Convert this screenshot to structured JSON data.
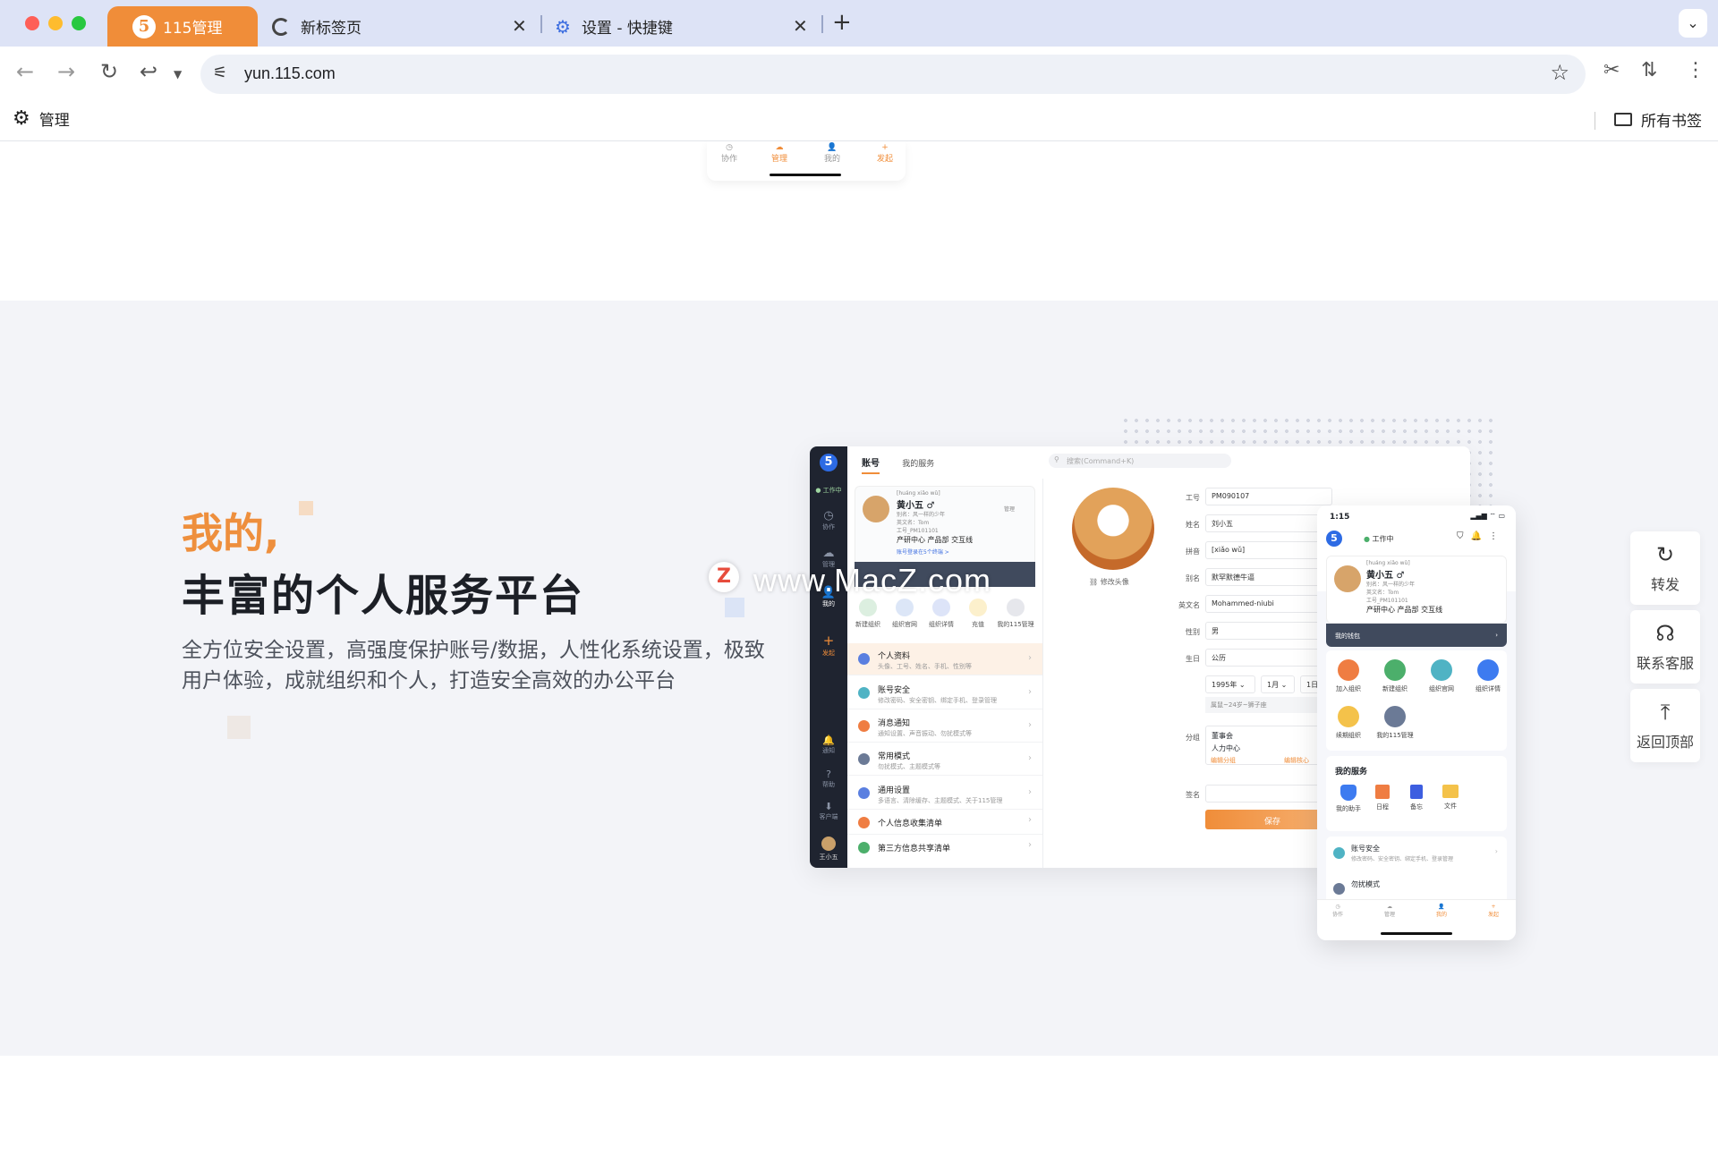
{
  "browser": {
    "tabs": [
      {
        "label": "115管理",
        "active": true
      },
      {
        "label": "新标签页",
        "active": false
      },
      {
        "label": "设置 - 快捷键",
        "active": false
      }
    ],
    "url": "yun.115.com",
    "bookmark_left": "管理",
    "bookmark_right": "所有书签"
  },
  "top_phone_nav": [
    "协作",
    "管理",
    "我的",
    "发起"
  ],
  "hero": {
    "title_accent": "我的,",
    "title_main": "丰富的个人服务平台",
    "description": "全方位安全设置，高强度保护账号/数据，人性化系统设置，极致用户体验，成就组织和个人，打造安全高效的办公平台"
  },
  "watermark": {
    "logo": "Z",
    "text": "www.MacZ.com"
  },
  "desktop_app": {
    "logo": "5",
    "status": "工作中",
    "sidebar": [
      "协作",
      "管理",
      "我的",
      "发起",
      "通知",
      "帮助",
      "客户端",
      "王小五"
    ],
    "tabs": [
      "账号",
      "我的服务"
    ],
    "search_placeholder": "搜索(Command+K)",
    "profile": {
      "pinyin": "[huáng xiǎo wǔ]",
      "name": "黄小五 ♂",
      "alias": "别名：风一样的少年",
      "english": "英文名：Tom",
      "id": "工号_PM101101",
      "dept": "产研中心 产品部 交互线",
      "login": "账号登录在5个终端 >",
      "badge": "管理"
    },
    "services": [
      "新建组织",
      "组织官网",
      "组织详情",
      "充值",
      "我的115管理"
    ],
    "menu": [
      {
        "title": "个人资料",
        "sub": "头像、工号、姓名、手机、性别等"
      },
      {
        "title": "账号安全",
        "sub": "修改密码、安全密钥、绑定手机、登录管理"
      },
      {
        "title": "消息通知",
        "sub": "通知设置、声音振动、勿扰模式等"
      },
      {
        "title": "常用模式",
        "sub": "勿扰模式、主题模式等"
      },
      {
        "title": "通用设置",
        "sub": "多语言、清除缓存、主题模式、关于115管理"
      },
      {
        "title": "个人信息收集清单",
        "sub": ""
      },
      {
        "title": "第三方信息共享清单",
        "sub": ""
      }
    ],
    "avatar_edit": "修改头像",
    "form": [
      {
        "label": "工号",
        "value": "PM090107"
      },
      {
        "label": "姓名",
        "value": "刘小五"
      },
      {
        "label": "拼音",
        "value": "[xiǎo wǔ]"
      },
      {
        "label": "别名",
        "value": "默罕默德牛逼"
      },
      {
        "label": "英文名",
        "value": "Mohammed-niubi"
      },
      {
        "label": "性别",
        "value": "男"
      },
      {
        "label": "生日",
        "value": "公历"
      }
    ],
    "birthday": {
      "year": "1995年",
      "month": "1月",
      "day": "1日",
      "zodiac": "属鼠~24岁~狮子座"
    },
    "group_label": "分组",
    "groups": [
      "董事会",
      "人力中心"
    ],
    "group_links": [
      "编辑分组",
      "编辑核心"
    ],
    "sign_label": "签名",
    "save": "保存"
  },
  "mobile_app": {
    "time": "1:15",
    "logo": "5",
    "status": "工作中",
    "profile": {
      "pinyin": "[huáng xiǎo wǔ]",
      "name": "黄小五 ♂",
      "alias": "别名：风一样的少年",
      "english": "英文名：Tom",
      "id": "工号_PM101101",
      "dept": "产研中心 产品部 交互线"
    },
    "wallet": "我的钱包",
    "services": [
      "加入组织",
      "新建组织",
      "组织官网",
      "组织详情",
      "续期组织",
      "我的115管理"
    ],
    "my_services_title": "我的服务",
    "my_services": [
      "我的助手",
      "日程",
      "备忘",
      "文件"
    ],
    "list": [
      {
        "title": "账号安全",
        "sub": "修改密码、安全密钥、绑定手机、登录管理"
      },
      {
        "title": "勿扰模式",
        "sub": ""
      }
    ],
    "nav": [
      "协作",
      "管理",
      "我的",
      "发起"
    ]
  },
  "floating": [
    {
      "icon": "share-icon",
      "label": "转发"
    },
    {
      "icon": "headset-icon",
      "label": "联系客服"
    },
    {
      "icon": "arrow-up-icon",
      "label": "返回顶部"
    }
  ],
  "colors": {
    "accent": "#f08d39",
    "tabbar": "#dde3f6",
    "section_bg": "#f3f4f8",
    "dark": "#1f2430"
  }
}
